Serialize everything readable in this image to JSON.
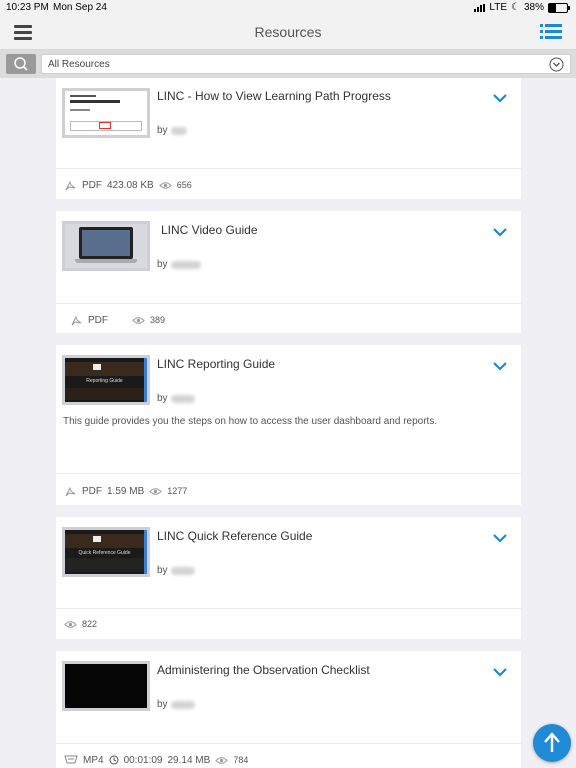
{
  "status": {
    "time": "10:23 PM",
    "date": "Mon Sep 24",
    "network": "LTE",
    "battery": "38%"
  },
  "header": {
    "title": "Resources"
  },
  "filter": {
    "selected": "All Resources"
  },
  "resources": [
    {
      "title": "LINC - How to View Learning Path Progress",
      "by": "by",
      "description": "",
      "type": "PDF",
      "size": "423.08 KB",
      "duration": "",
      "views": "656"
    },
    {
      "title": "LINC  Video Guide",
      "by": "by",
      "description": "",
      "type": "PDF",
      "size": "",
      "duration": "",
      "views": "389"
    },
    {
      "title": "LINC Reporting Guide",
      "by": "by",
      "description": "This guide provides you the steps on how to access the user dashboard and reports.",
      "type": "PDF",
      "size": "1.59 MB",
      "duration": "",
      "views": "1277"
    },
    {
      "title": "LINC Quick Reference Guide",
      "by": "by",
      "description": "",
      "type": "",
      "size": "",
      "duration": "",
      "views": "822"
    },
    {
      "title": "Administering the Observation Checklist",
      "by": "by",
      "description": "",
      "type": "MP4",
      "size": "29.14 MB",
      "duration": "00:01:09",
      "views": "784"
    }
  ],
  "thumbnails": [
    "Reporting Guide",
    "Quick Reference Guide"
  ],
  "colors": {
    "accent": "#1f8ad6",
    "chevron": "#1a8ad6"
  }
}
